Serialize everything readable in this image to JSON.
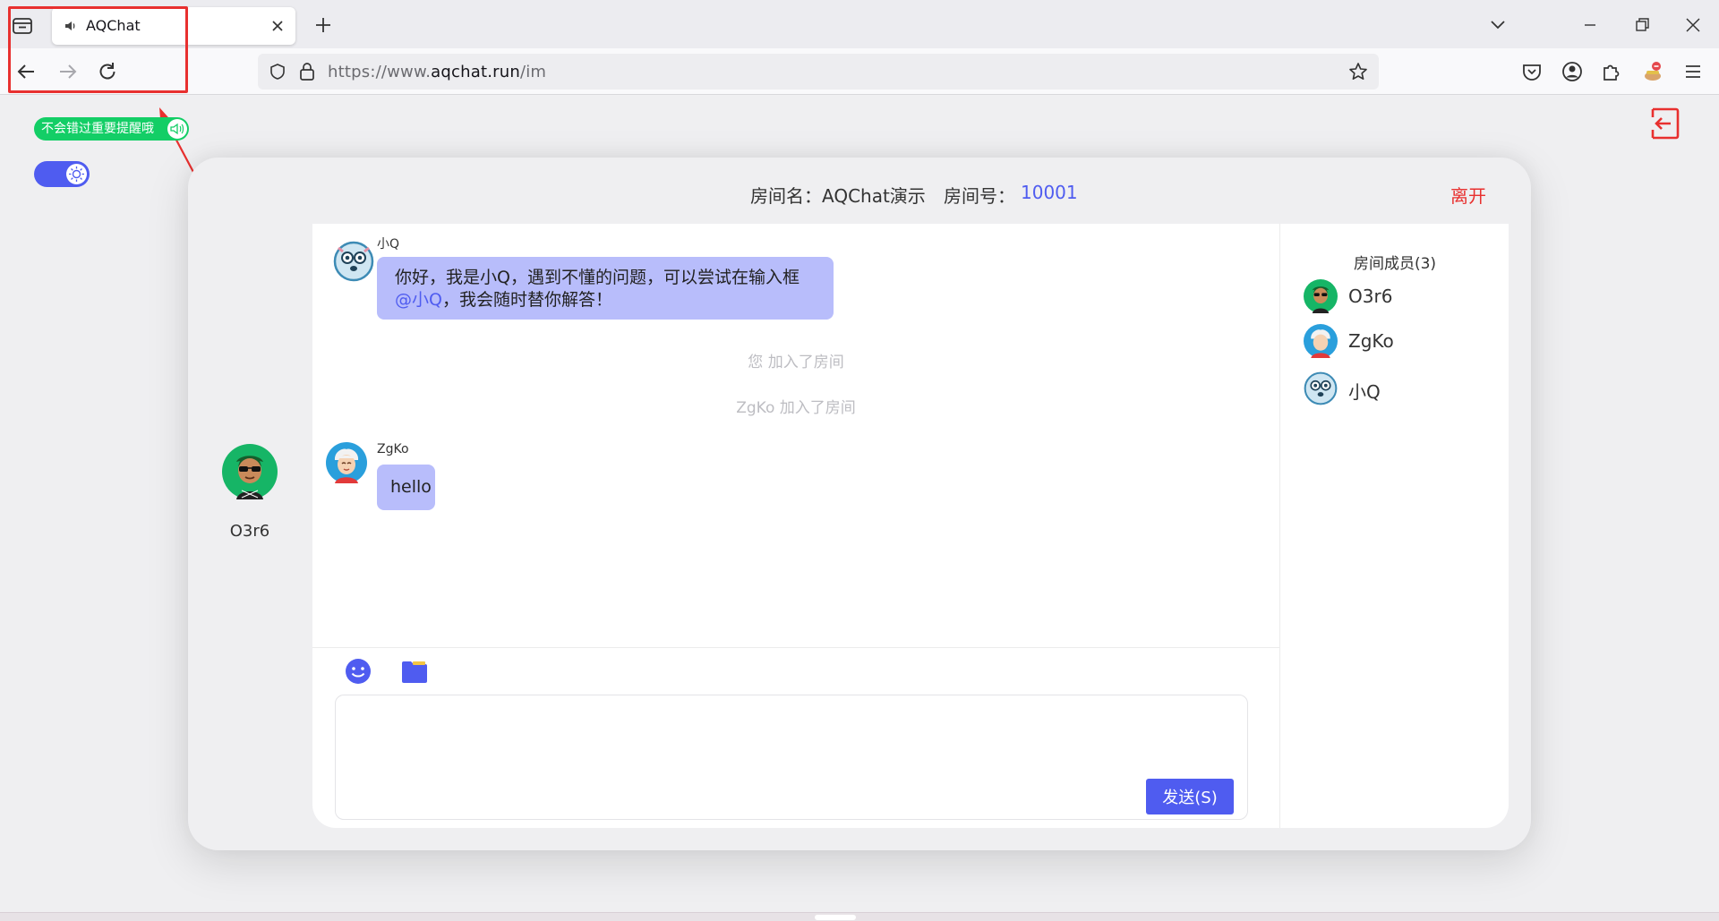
{
  "browser": {
    "tab_title": "AQChat",
    "url_prefix": "https://www.",
    "url_domain": "aqchat.run",
    "url_path": "/im",
    "icons": {
      "tab_list": "tab-list-icon",
      "speaker": "speaker-icon",
      "close_tab": "close-icon",
      "new_tab": "plus-icon",
      "overflow": "chevron-down-icon",
      "back": "arrow-left-icon",
      "forward": "arrow-right-icon",
      "reload": "reload-icon",
      "shield": "shield-icon",
      "lock": "lock-icon",
      "bookmark": "star-icon",
      "pocket": "pocket-icon",
      "account": "account-icon",
      "extensions": "puzzle-icon",
      "profile": "profile-icon",
      "menu": "hamburger-icon"
    }
  },
  "page": {
    "notify_label": "不会错过重要提醒哦",
    "room": {
      "name_label": "房间名：AQChat演示",
      "number_label": "房间号：",
      "number": "10001",
      "leave_label": "离开"
    },
    "self_user": {
      "name": "O3r6"
    },
    "messages": [
      {
        "sender": "小Q",
        "text_before": "你好，我是小Q，遇到不懂的问题，可以尝试在输入框",
        "mention": "@小Q",
        "text_after": "，我会随时替你解答！"
      },
      {
        "system": "您 加入了房间"
      },
      {
        "system": "ZgKo 加入了房间"
      },
      {
        "sender": "ZgKo",
        "text": "hello"
      }
    ],
    "composer": {
      "send_label": "发送(S)",
      "input_value": ""
    },
    "members_title": "房间成员(3)",
    "members": [
      {
        "name": "O3r6"
      },
      {
        "name": "ZgKo"
      },
      {
        "name": "小Q"
      }
    ]
  },
  "colors": {
    "accent": "#4f5cf0",
    "bubble": "#b8bdfb",
    "leave_red": "#e8302f",
    "toggle_green": "#13ce66",
    "annotation_red": "#e8302f"
  }
}
